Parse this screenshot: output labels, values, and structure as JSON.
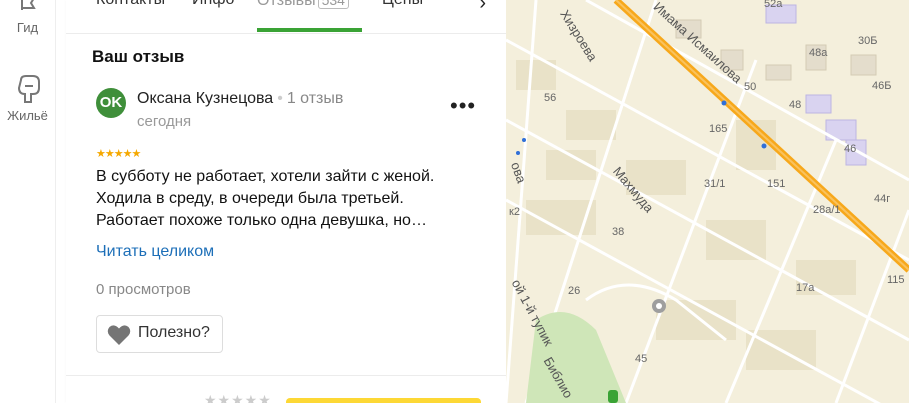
{
  "rail": {
    "items": [
      {
        "label": "Гид",
        "icon": "guide-icon"
      },
      {
        "label": "Жильё",
        "icon": "housing-icon"
      }
    ]
  },
  "tabs": {
    "items": [
      {
        "label": "Контакты"
      },
      {
        "label": "Инфо"
      },
      {
        "label": "Отзывы",
        "count": "534",
        "active": true
      },
      {
        "label": "Цены"
      }
    ]
  },
  "review": {
    "section_title": "Ваш отзыв",
    "avatar_initials": "OK",
    "author": "Оксана Кузнецова",
    "author_reviews": "1 отзыв",
    "date": "сегодня",
    "rating": 5,
    "stars": "★★★★★",
    "text_lines": [
      "В субботу не работает, хотели зайти с женой.",
      "Ходила в среду, в очереди была третьей.",
      "Работает похоже только одна девушка, но…"
    ],
    "read_more": "Читать целиком",
    "views": "0 просмотров",
    "useful_label": "Полезно?",
    "more_icon": "more-dots-icon"
  },
  "bottom": {
    "empty_stars": "★★★★★"
  },
  "map": {
    "streets": [
      "Хизроева",
      "Имама Исмаилова",
      "Махмуда",
      "Библио",
      "ой 1-й тупик",
      "ова"
    ],
    "house_numbers": [
      "52а",
      "48а",
      "30Б",
      "46Б",
      "50",
      "48",
      "56",
      "165",
      "46",
      "31/1",
      "151",
      "28а/1",
      "44г",
      "к2",
      "38",
      "17а",
      "26",
      "115",
      "45"
    ]
  },
  "colors": {
    "accent_green": "#3aa335",
    "link_blue": "#1d6fb8",
    "star_gold": "#f5a800",
    "avatar_green": "#3f8f3a",
    "main_road": "#f7a81b"
  }
}
